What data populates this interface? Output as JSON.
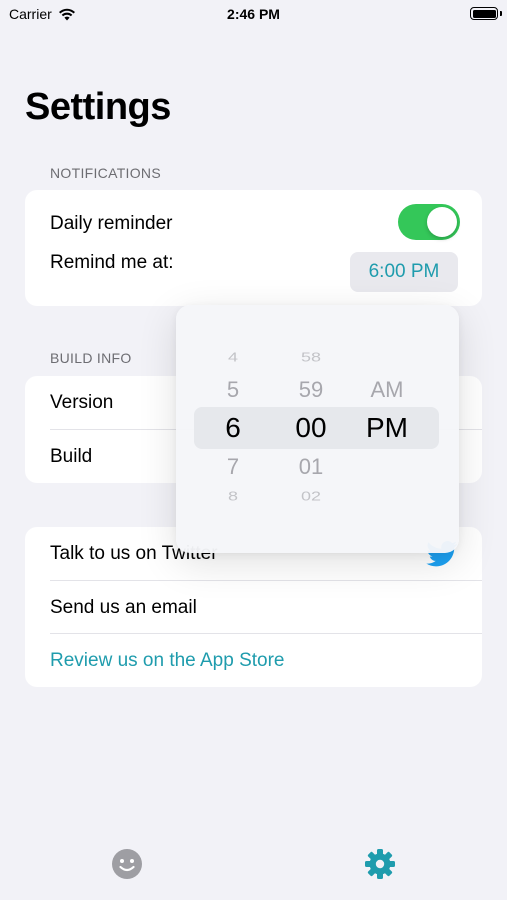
{
  "status_bar": {
    "carrier": "Carrier",
    "time": "2:46 PM"
  },
  "page": {
    "title": "Settings"
  },
  "notifications": {
    "header": "NOTIFICATIONS",
    "daily_reminder_label": "Daily reminder",
    "daily_reminder_on": true,
    "remind_at_label": "Remind me at:",
    "remind_at_value": "6:00 PM"
  },
  "build_info": {
    "header": "BUILD INFO",
    "version_label": "Version",
    "build_label": "Build"
  },
  "links": {
    "twitter": "Talk to us on Twitter",
    "email": "Send us an email",
    "review": "Review us on the App Store"
  },
  "picker": {
    "hours": [
      "4",
      "5",
      "6",
      "7",
      "8"
    ],
    "minutes": [
      "58",
      "59",
      "00",
      "01",
      "02"
    ],
    "periods": [
      "AM",
      "PM"
    ],
    "selected": {
      "hour": "6",
      "minute": "00",
      "period": "PM"
    }
  },
  "tabs": [
    {
      "icon": "smiley-icon",
      "color": "#9e9ea3"
    },
    {
      "icon": "gear-icon",
      "color": "#1f9cad"
    }
  ],
  "colors": {
    "accent": "#1f9cad",
    "toggle_on": "#34c759",
    "twitter": "#1da1f2"
  }
}
